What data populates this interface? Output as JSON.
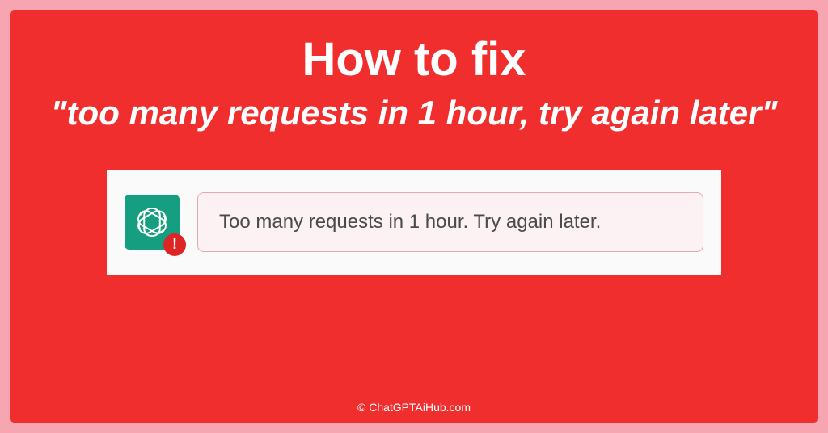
{
  "colors": {
    "outer_bg": "#f7a5b0",
    "inner_bg": "#f12e2e",
    "text_white": "#ffffff",
    "card_bg": "#fafafa",
    "logo_bg": "#159f80",
    "badge_bg": "#dc2626",
    "bubble_bg": "#fdf2f3",
    "bubble_border": "#e4a8ae",
    "bubble_text": "#4a4a4a"
  },
  "heading": {
    "title": "How to fix",
    "subtitle": "\"too many requests in 1 hour, try again later\""
  },
  "error": {
    "message": "Too many requests in 1 hour. Try again later.",
    "badge_symbol": "!"
  },
  "footer": {
    "credit": "© ChatGPTAiHub.com"
  }
}
